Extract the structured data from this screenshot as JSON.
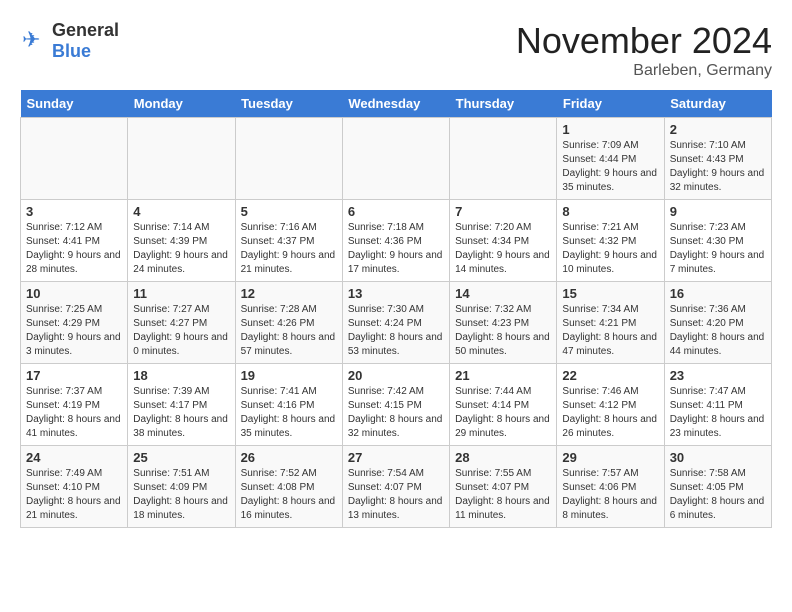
{
  "logo": {
    "general": "General",
    "blue": "Blue"
  },
  "title": "November 2024",
  "location": "Barleben, Germany",
  "days_of_week": [
    "Sunday",
    "Monday",
    "Tuesday",
    "Wednesday",
    "Thursday",
    "Friday",
    "Saturday"
  ],
  "weeks": [
    [
      {
        "day": "",
        "info": ""
      },
      {
        "day": "",
        "info": ""
      },
      {
        "day": "",
        "info": ""
      },
      {
        "day": "",
        "info": ""
      },
      {
        "day": "",
        "info": ""
      },
      {
        "day": "1",
        "info": "Sunrise: 7:09 AM\nSunset: 4:44 PM\nDaylight: 9 hours and 35 minutes."
      },
      {
        "day": "2",
        "info": "Sunrise: 7:10 AM\nSunset: 4:43 PM\nDaylight: 9 hours and 32 minutes."
      }
    ],
    [
      {
        "day": "3",
        "info": "Sunrise: 7:12 AM\nSunset: 4:41 PM\nDaylight: 9 hours and 28 minutes."
      },
      {
        "day": "4",
        "info": "Sunrise: 7:14 AM\nSunset: 4:39 PM\nDaylight: 9 hours and 24 minutes."
      },
      {
        "day": "5",
        "info": "Sunrise: 7:16 AM\nSunset: 4:37 PM\nDaylight: 9 hours and 21 minutes."
      },
      {
        "day": "6",
        "info": "Sunrise: 7:18 AM\nSunset: 4:36 PM\nDaylight: 9 hours and 17 minutes."
      },
      {
        "day": "7",
        "info": "Sunrise: 7:20 AM\nSunset: 4:34 PM\nDaylight: 9 hours and 14 minutes."
      },
      {
        "day": "8",
        "info": "Sunrise: 7:21 AM\nSunset: 4:32 PM\nDaylight: 9 hours and 10 minutes."
      },
      {
        "day": "9",
        "info": "Sunrise: 7:23 AM\nSunset: 4:30 PM\nDaylight: 9 hours and 7 minutes."
      }
    ],
    [
      {
        "day": "10",
        "info": "Sunrise: 7:25 AM\nSunset: 4:29 PM\nDaylight: 9 hours and 3 minutes."
      },
      {
        "day": "11",
        "info": "Sunrise: 7:27 AM\nSunset: 4:27 PM\nDaylight: 9 hours and 0 minutes."
      },
      {
        "day": "12",
        "info": "Sunrise: 7:28 AM\nSunset: 4:26 PM\nDaylight: 8 hours and 57 minutes."
      },
      {
        "day": "13",
        "info": "Sunrise: 7:30 AM\nSunset: 4:24 PM\nDaylight: 8 hours and 53 minutes."
      },
      {
        "day": "14",
        "info": "Sunrise: 7:32 AM\nSunset: 4:23 PM\nDaylight: 8 hours and 50 minutes."
      },
      {
        "day": "15",
        "info": "Sunrise: 7:34 AM\nSunset: 4:21 PM\nDaylight: 8 hours and 47 minutes."
      },
      {
        "day": "16",
        "info": "Sunrise: 7:36 AM\nSunset: 4:20 PM\nDaylight: 8 hours and 44 minutes."
      }
    ],
    [
      {
        "day": "17",
        "info": "Sunrise: 7:37 AM\nSunset: 4:19 PM\nDaylight: 8 hours and 41 minutes."
      },
      {
        "day": "18",
        "info": "Sunrise: 7:39 AM\nSunset: 4:17 PM\nDaylight: 8 hours and 38 minutes."
      },
      {
        "day": "19",
        "info": "Sunrise: 7:41 AM\nSunset: 4:16 PM\nDaylight: 8 hours and 35 minutes."
      },
      {
        "day": "20",
        "info": "Sunrise: 7:42 AM\nSunset: 4:15 PM\nDaylight: 8 hours and 32 minutes."
      },
      {
        "day": "21",
        "info": "Sunrise: 7:44 AM\nSunset: 4:14 PM\nDaylight: 8 hours and 29 minutes."
      },
      {
        "day": "22",
        "info": "Sunrise: 7:46 AM\nSunset: 4:12 PM\nDaylight: 8 hours and 26 minutes."
      },
      {
        "day": "23",
        "info": "Sunrise: 7:47 AM\nSunset: 4:11 PM\nDaylight: 8 hours and 23 minutes."
      }
    ],
    [
      {
        "day": "24",
        "info": "Sunrise: 7:49 AM\nSunset: 4:10 PM\nDaylight: 8 hours and 21 minutes."
      },
      {
        "day": "25",
        "info": "Sunrise: 7:51 AM\nSunset: 4:09 PM\nDaylight: 8 hours and 18 minutes."
      },
      {
        "day": "26",
        "info": "Sunrise: 7:52 AM\nSunset: 4:08 PM\nDaylight: 8 hours and 16 minutes."
      },
      {
        "day": "27",
        "info": "Sunrise: 7:54 AM\nSunset: 4:07 PM\nDaylight: 8 hours and 13 minutes."
      },
      {
        "day": "28",
        "info": "Sunrise: 7:55 AM\nSunset: 4:07 PM\nDaylight: 8 hours and 11 minutes."
      },
      {
        "day": "29",
        "info": "Sunrise: 7:57 AM\nSunset: 4:06 PM\nDaylight: 8 hours and 8 minutes."
      },
      {
        "day": "30",
        "info": "Sunrise: 7:58 AM\nSunset: 4:05 PM\nDaylight: 8 hours and 6 minutes."
      }
    ]
  ]
}
